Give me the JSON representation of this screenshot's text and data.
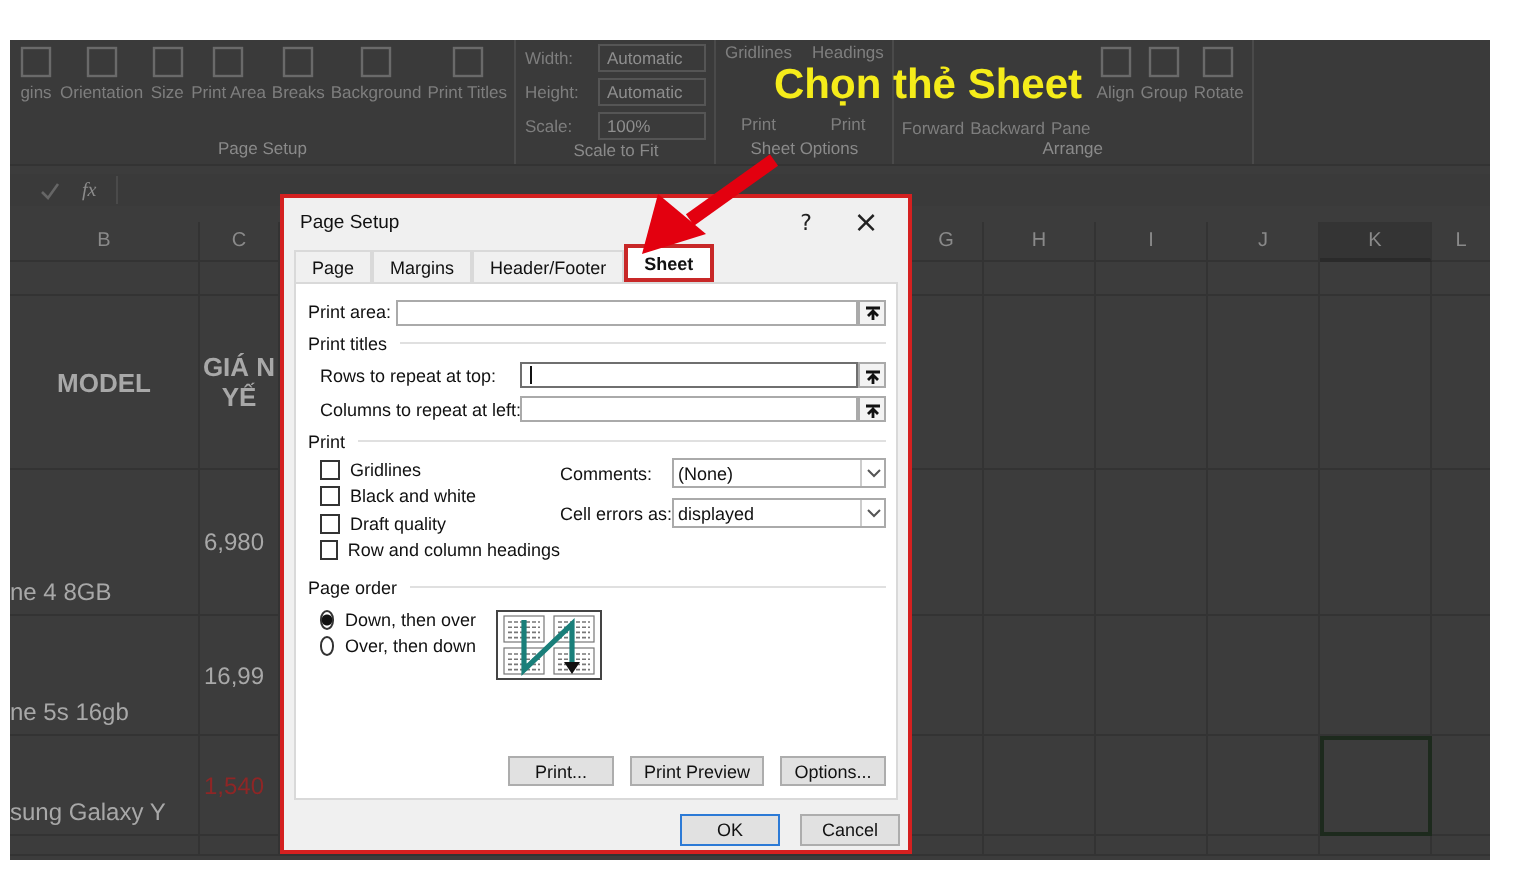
{
  "annotation": {
    "text": "Chọn thẻ Sheet"
  },
  "ribbon": {
    "groups": [
      {
        "kind": "buttons",
        "label": "Page Setup",
        "items": [
          "gins",
          "Orientation",
          "Size",
          "Print Area",
          "Breaks",
          "Background",
          "Print Titles"
        ]
      },
      {
        "kind": "fields",
        "label": "Scale to Fit",
        "fields": [
          {
            "label": "Width:",
            "value": "Automatic"
          },
          {
            "label": "Height:",
            "value": "Automatic"
          },
          {
            "label": "Scale:",
            "value": "100%"
          }
        ]
      },
      {
        "kind": "options",
        "label": "Sheet Options",
        "columns": [
          "Gridlines",
          "Headings"
        ],
        "checks": [
          "Print",
          "Print"
        ]
      },
      {
        "kind": "buttons",
        "label": "Arrange",
        "items": [
          "Forward",
          "Backward",
          "Pane",
          "Align",
          "Group",
          "Rotate"
        ],
        "icons": [
          false,
          false,
          false,
          true,
          true,
          true
        ]
      }
    ]
  },
  "formula_bar": {
    "function_label": "fx"
  },
  "grid": {
    "columns": [
      {
        "label": "B",
        "selected": false
      },
      {
        "label": "C",
        "selected": false
      },
      {
        "label": "G",
        "selected": false
      },
      {
        "label": "H",
        "selected": false
      },
      {
        "label": "I",
        "selected": false
      },
      {
        "label": "J",
        "selected": false
      },
      {
        "label": "K",
        "selected": true
      },
      {
        "label": "L",
        "selected": false
      }
    ],
    "rows": [
      {
        "selected": false
      },
      {
        "model": "MODEL",
        "price": "GIÁ N YẾ",
        "color": "#a8a8a8",
        "selected": false
      },
      {
        "model": "ne 4 8GB",
        "price": "6,980",
        "color": "#a8a8a8",
        "selected": false
      },
      {
        "model": "ne 5s 16gb",
        "price": "16,99",
        "color": "#a8a8a8",
        "selected": false
      },
      {
        "model": "sung Galaxy Y",
        "price": "1,540",
        "color": "#8e2626",
        "selected": true
      },
      {
        "selected": false
      }
    ]
  },
  "dialog": {
    "title": "Page Setup",
    "help": "?",
    "close": "×",
    "tabs": [
      {
        "label": "Page",
        "selected": false
      },
      {
        "label": "Margins",
        "selected": false
      },
      {
        "label": "Header/Footer",
        "selected": false
      },
      {
        "label": "Sheet",
        "selected": true
      }
    ],
    "print_area": {
      "label": "Print area:",
      "focused": false
    },
    "print_titles": {
      "heading": "Print titles",
      "fields": [
        {
          "label": "Rows to repeat at top:",
          "focused": true
        },
        {
          "label": "Columns to repeat at left:",
          "focused": false
        }
      ]
    },
    "print": {
      "heading": "Print",
      "checkboxes": [
        {
          "label": "Gridlines",
          "checked": false
        },
        {
          "label": "Black and white",
          "checked": false
        },
        {
          "label": "Draft quality",
          "checked": false
        },
        {
          "label": "Row and column headings",
          "checked": false
        }
      ],
      "dropdowns": [
        {
          "label": "Comments:",
          "value": "(None)"
        },
        {
          "label": "Cell errors as:",
          "value": "displayed"
        }
      ]
    },
    "page_order": {
      "heading": "Page order",
      "options": [
        {
          "label": "Down, then over",
          "selected": true
        },
        {
          "label": "Over, then down",
          "selected": false
        }
      ]
    },
    "panel_buttons": [
      "Print...",
      "Print Preview",
      "Options..."
    ],
    "buttons": [
      {
        "label": "OK",
        "default": true
      },
      {
        "label": "Cancel",
        "default": false
      }
    ]
  }
}
